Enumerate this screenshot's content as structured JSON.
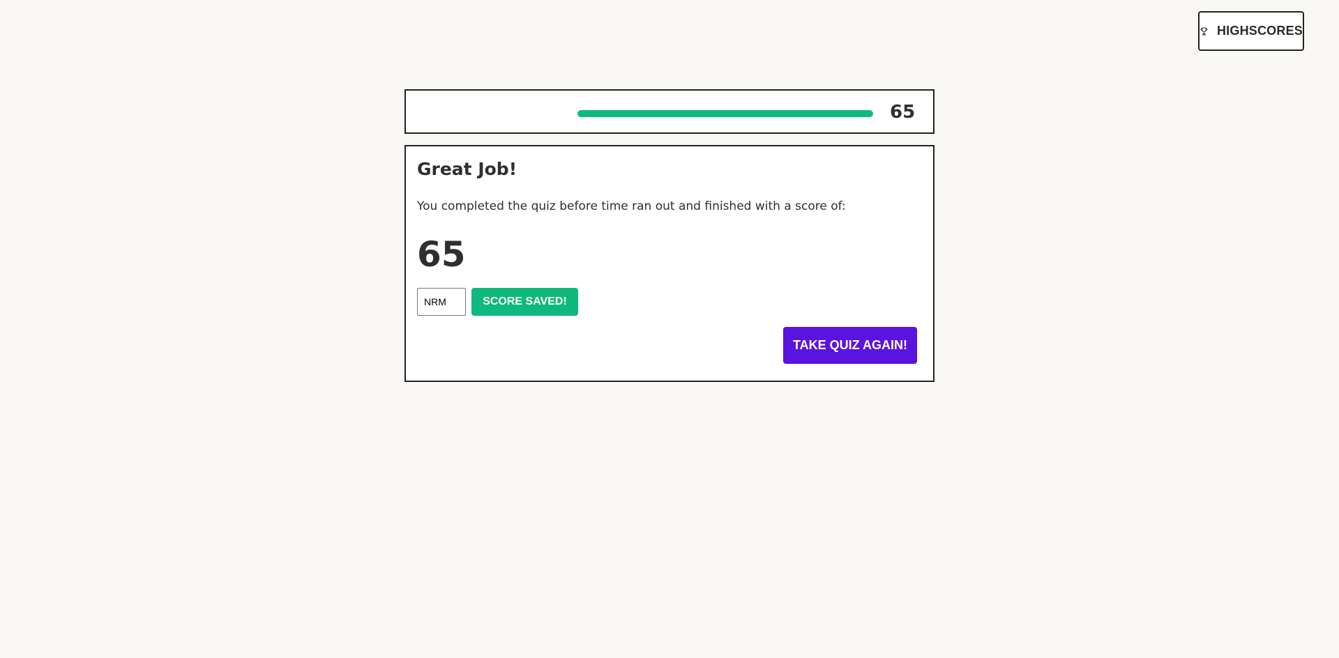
{
  "header": {
    "highscores_label": "HIGHSCORES",
    "highscores_icon": "trophy-icon"
  },
  "timer": {
    "value": "65",
    "progress_percent": 100,
    "bar_color": "#0fb87c"
  },
  "result": {
    "title": "Great Job!",
    "message": "You completed the quiz before time ran out and finished with a score of:",
    "score": "65",
    "initials_value": "NRM",
    "save_label": "SCORE SAVED!",
    "save_color": "#0fb87c",
    "again_label": "TAKE QUIZ AGAIN!",
    "again_color": "#5b13e0"
  }
}
